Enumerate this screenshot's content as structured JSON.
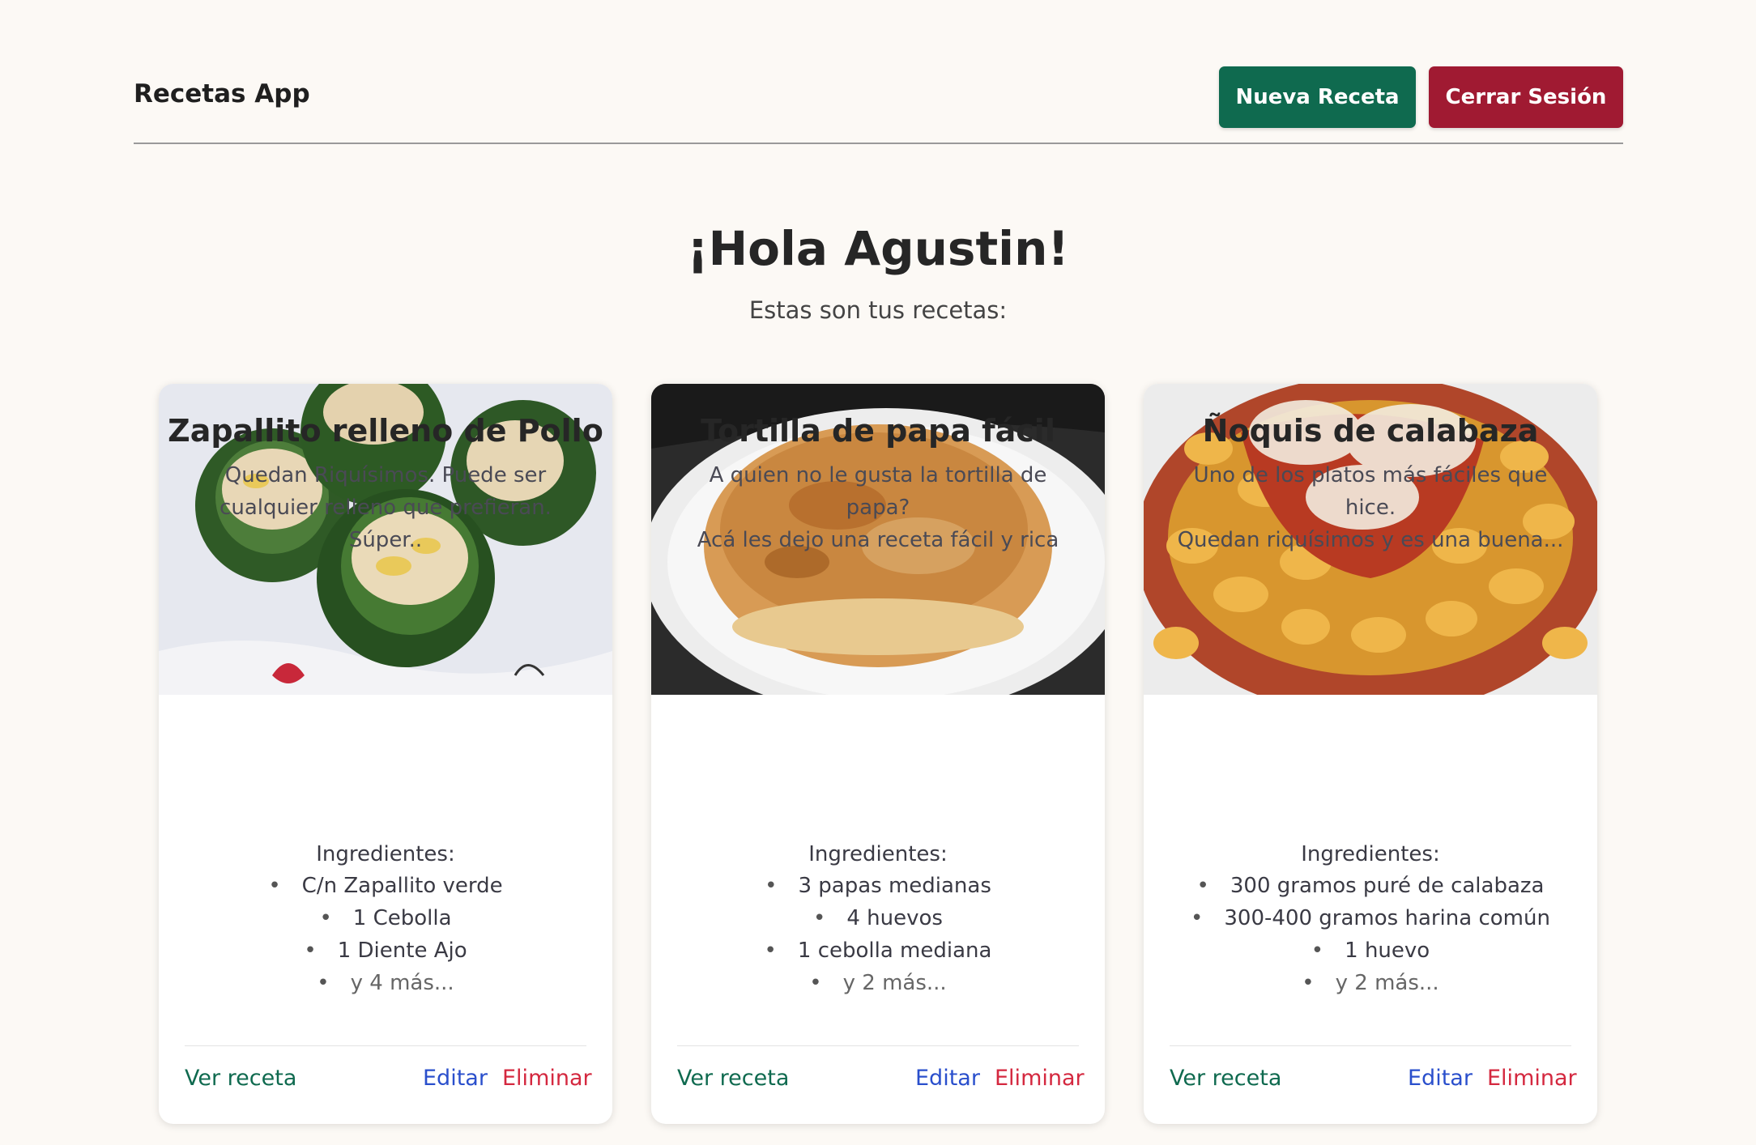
{
  "header": {
    "brand": "Recetas App",
    "new_recipe": "Nueva Receta",
    "logout": "Cerrar Sesión"
  },
  "main": {
    "greeting": "¡Hola Agustin!",
    "subtitle": "Estas son tus recetas:"
  },
  "recipes": [
    {
      "title": "Zapallito relleno de Pollo",
      "description": "Quedan Riquísimos. Puede ser\ncualquier relleno que prefieran. Súper..",
      "ingredients_label": "Ingredientes:",
      "ingredients": [
        "C/n Zapallito verde",
        "1 Cebolla",
        "1 Diente Ajo"
      ],
      "more": "y 4 más...",
      "view": "Ver receta",
      "edit": "Editar",
      "delete": "Eliminar"
    },
    {
      "title": "Tortilla de papa fácil",
      "description": "A quien no le gusta la tortilla de papa?\nAcá les dejo una receta fácil y rica",
      "ingredients_label": "Ingredientes:",
      "ingredients": [
        "3 papas medianas",
        "4 huevos",
        "1 cebolla mediana"
      ],
      "more": "y 2 más...",
      "view": "Ver receta",
      "edit": "Editar",
      "delete": "Eliminar"
    },
    {
      "title": "Ñoquis de calabaza",
      "description": "Uno de los platos más fáciles que hice.\nQuedan riquísimos y es una buena...",
      "ingredients_label": "Ingredientes:",
      "ingredients": [
        "300 gramos puré de calabaza",
        "300-400 gramos harina común",
        "1 huevo"
      ],
      "more": "y 2 más...",
      "view": "Ver receta",
      "edit": "Editar",
      "delete": "Eliminar"
    }
  ],
  "colors": {
    "background": "#fcf9f5",
    "primary": "#0f6a4f",
    "danger": "#a01a32",
    "link_edit": "#2a4fcc",
    "link_delete": "#d4283f"
  }
}
